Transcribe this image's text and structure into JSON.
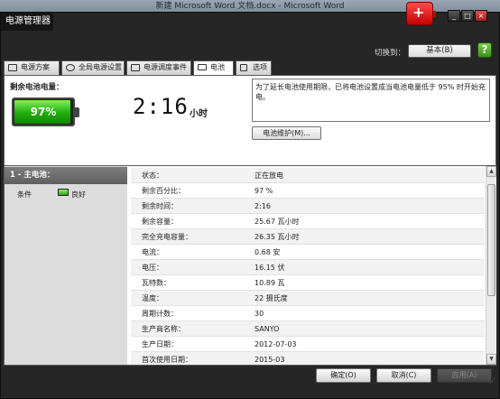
{
  "background_window": {
    "title": "新建 Microsoft Word 文档.docx - Microsoft Word",
    "ribbon_tabs": [
      "审阅",
      "视图"
    ]
  },
  "app": {
    "title": "电源管理器",
    "window_buttons": [
      "_",
      "□",
      "×"
    ]
  },
  "switch_bar": {
    "label": "切换到：",
    "value": "基本(B)"
  },
  "tabs": [
    {
      "label": "电源方案",
      "icon": "power-plan-icon"
    },
    {
      "label": "全局电源设置",
      "icon": "gear-icon"
    },
    {
      "label": "电源调度事件",
      "icon": "schedule-icon"
    },
    {
      "label": "电池",
      "icon": "battery-icon",
      "active": true
    },
    {
      "label": "选项",
      "icon": "checkbox-icon"
    }
  ],
  "battery": {
    "remaining_label": "剩余电池电量：",
    "percent_text": "97%",
    "percent": 97,
    "time_remaining": "2:16",
    "time_unit": "小时",
    "note": "为了延长电池使用期限，已将电池设置成当电池电量低于 95% 时开始充电。",
    "maintenance_button": "电池维护(M)..."
  },
  "left_pane": {
    "header": "1 - 主电池：",
    "condition_label": "条件",
    "condition_value": "良好"
  },
  "details": [
    {
      "key": "状态：",
      "value": "正在放电"
    },
    {
      "key": "剩余百分比：",
      "value": "97 %"
    },
    {
      "key": "剩余时间：",
      "value": "2:16"
    },
    {
      "key": "剩余容量：",
      "value": "25.67 瓦小时"
    },
    {
      "key": "完全充电容量：",
      "value": "26.35 瓦小时"
    },
    {
      "key": "电流：",
      "value": "0.68 安"
    },
    {
      "key": "电压：",
      "value": "16.15 伏"
    },
    {
      "key": "瓦特数：",
      "value": "10.89 瓦"
    },
    {
      "key": "温度：",
      "value": "22 摄氏度"
    },
    {
      "key": "周期计数：",
      "value": "30"
    },
    {
      "key": "生产商名称：",
      "value": "SANYO"
    },
    {
      "key": "生产日期：",
      "value": "2012-07-03"
    },
    {
      "key": "首次使用日期：",
      "value": "2015-03"
    }
  ],
  "buttons": {
    "ok": "确定(O)",
    "cancel": "取消(C)",
    "apply": "应用(A)"
  }
}
